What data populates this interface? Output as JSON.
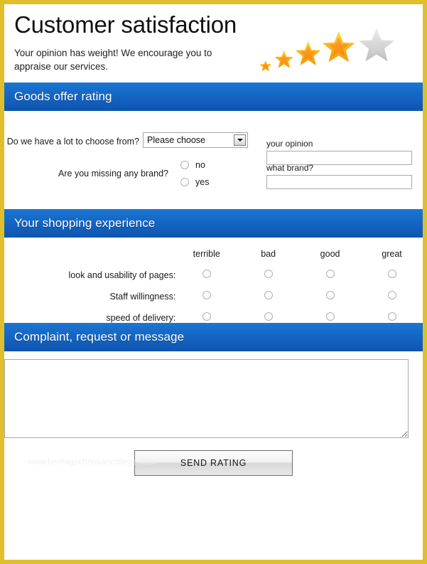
{
  "header": {
    "title": "Customer satisfaction",
    "subtitle": "Your opinion has weight! We encourage you to appraise our services.",
    "stars_icon": "five-star-rating-icon",
    "star_count": 5,
    "stars_filled": 4
  },
  "sections": {
    "goods": {
      "bar_title": "Goods offer rating",
      "q1": {
        "label": "Do we have a lot to choose from?",
        "select_value": "Please choose",
        "select_options": [
          "Please choose"
        ],
        "opinion_label": "your opinion",
        "opinion_value": "",
        "opinion_placeholder": ""
      },
      "q2": {
        "label": "Are you missing any brand?",
        "options": [
          "no",
          "yes"
        ],
        "brand_label": "what brand?",
        "brand_value": "",
        "brand_placeholder": ""
      }
    },
    "shopping": {
      "bar_title": "Your shopping experience",
      "columns": [
        "terrible",
        "bad",
        "good",
        "great"
      ],
      "rows": [
        "look and usability of pages:",
        "Staff willingness:",
        "speed of delivery:"
      ]
    },
    "message": {
      "bar_title": "Complaint, request or message",
      "textarea_value": "",
      "textarea_placeholder": "",
      "send_label": "SEND RATING"
    }
  },
  "watermark": "www.heritagechristiancollege.com",
  "colors": {
    "frame": "#dfc02c",
    "bar_top": "#1b76d2",
    "bar_bottom": "#0e55ae",
    "star_gold": "#f5a623",
    "star_gray": "#c9c9c9"
  }
}
